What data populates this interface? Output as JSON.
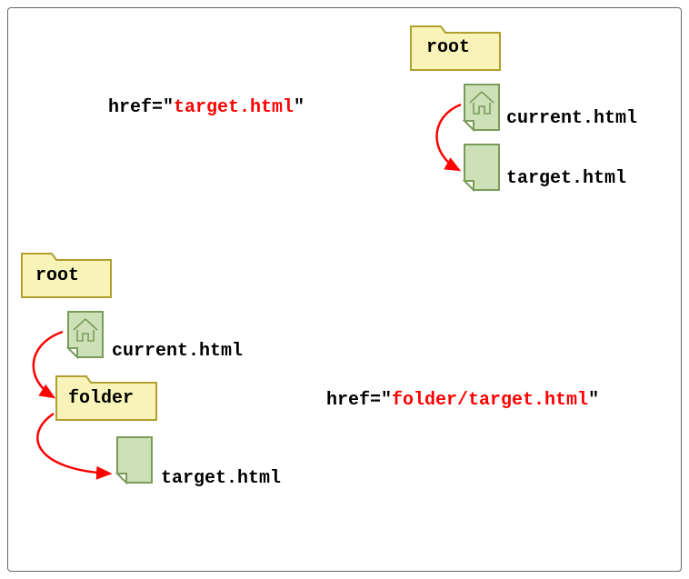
{
  "diagram1": {
    "href_prefix": "href=\"",
    "href_value": "target.html",
    "href_suffix": "\"",
    "root_label": "root",
    "current_label": "current.html",
    "target_label": "target.html"
  },
  "diagram2": {
    "href_prefix": "href=\"",
    "href_value": "folder/target.html",
    "href_suffix": "\"",
    "root_label": "root",
    "current_label": "current.html",
    "folder_label": "folder",
    "target_label": "target.html"
  },
  "colors": {
    "folder_fill": "#f8f3b8",
    "folder_stroke": "#b0a030",
    "file_fill": "#cde0b8",
    "file_stroke": "#7a9c5a",
    "arrow": "#ff0000"
  }
}
